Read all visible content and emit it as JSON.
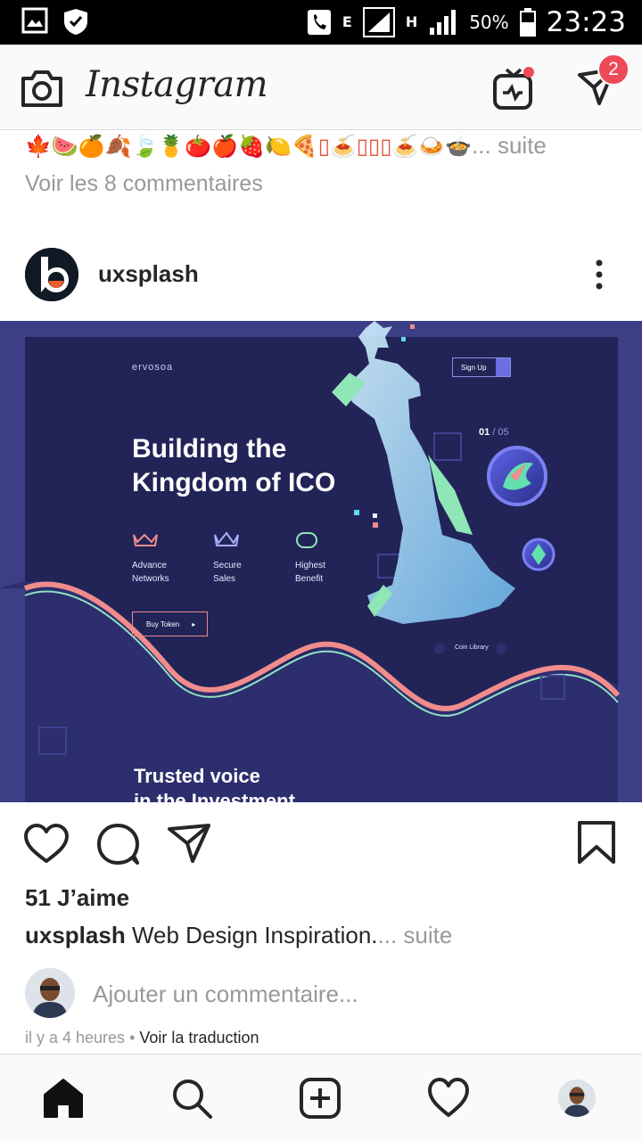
{
  "status_bar": {
    "network_letter_1": "E",
    "network_letter_2": "H",
    "battery_percent": "50%",
    "time": "23:23",
    "icons": [
      "image-notification-icon",
      "shield-notification-icon",
      "call-icon",
      "signal-icon",
      "battery-icon"
    ]
  },
  "app_bar": {
    "logo_text": "Instagram",
    "dm_badge_count": "2",
    "icons": [
      "camera-icon",
      "igtv-icon",
      "direct-message-icon"
    ]
  },
  "previous_post": {
    "caption_emojis": "🍁🍉🍊🍂🍃🍍🍅🍎🍓🍋🍕▯🍝▯▯▯🍝🍛🍲",
    "caption_more": "... suite",
    "view_comments": "Voir les 8 commentaires"
  },
  "post": {
    "username": "uxsplash",
    "image": {
      "brand": "ervosoa",
      "signup_label": "Sign Up",
      "hero_title_line1": "Building the",
      "hero_title_line2": "Kingdom of ICO",
      "features": [
        {
          "line1": "Advance",
          "line2": "Networks"
        },
        {
          "line1": "Secure",
          "line2": "Sales"
        },
        {
          "line1": "Highest",
          "line2": "Benefit"
        }
      ],
      "buy_token_label": "Buy Token",
      "slide_current": "01",
      "slide_total": "/ 05",
      "coin_library_label": "Coin Library",
      "trusted_line1": "Trusted voice",
      "trusted_line2": "in the Investment"
    },
    "likes": "51 J’aime",
    "caption_username": "uxsplash",
    "caption_text": "Web Design Inspiration.",
    "caption_more": "... suite",
    "add_comment_placeholder": "Ajouter un commentaire...",
    "time_ago": "il y a 4 heures",
    "separator": "•",
    "translate": "Voir la traduction"
  },
  "bottom_nav": {
    "items": [
      "home-icon",
      "search-icon",
      "new-post-icon",
      "activity-icon",
      "profile-avatar"
    ]
  },
  "colors": {
    "accent_red": "#ed4956",
    "post_image_bg": "#3c3f86",
    "secondary_text": "#999999"
  }
}
